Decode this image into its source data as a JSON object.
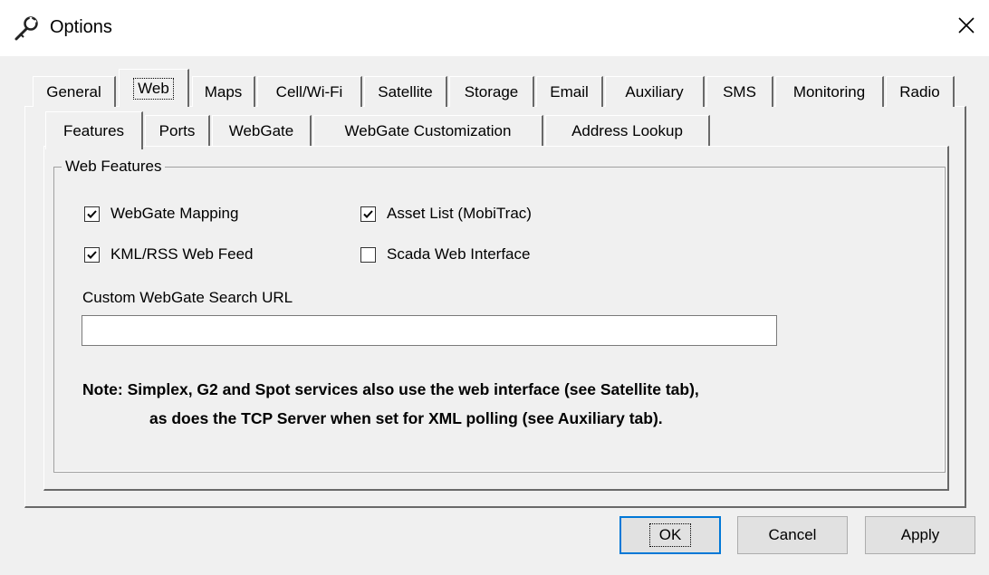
{
  "window": {
    "title": "Options",
    "icon": "wrench-key-icon"
  },
  "outer_tabs": [
    {
      "label": "General"
    },
    {
      "label": "Web",
      "active": true
    },
    {
      "label": "Maps"
    },
    {
      "label": "Cell/Wi-Fi"
    },
    {
      "label": "Satellite"
    },
    {
      "label": "Storage"
    },
    {
      "label": "Email"
    },
    {
      "label": "Auxiliary"
    },
    {
      "label": "SMS"
    },
    {
      "label": "Monitoring"
    },
    {
      "label": "Radio"
    }
  ],
  "inner_tabs": [
    {
      "label": "Features",
      "active": true
    },
    {
      "label": "Ports"
    },
    {
      "label": "WebGate"
    },
    {
      "label": "WebGate Customization"
    },
    {
      "label": "Address Lookup"
    }
  ],
  "web_features": {
    "group_label": "Web Features",
    "checkboxes": [
      {
        "label": "WebGate Mapping",
        "checked": true
      },
      {
        "label": "Asset List (MobiTrac)",
        "checked": true
      },
      {
        "label": "KML/RSS Web Feed",
        "checked": true
      },
      {
        "label": "Scada Web Interface",
        "checked": false
      }
    ],
    "search_url_label": "Custom WebGate Search URL",
    "search_url_value": "",
    "note_line1": "Note:  Simplex, G2 and Spot services also use the web interface (see Satellite tab),",
    "note_line2": "as does the TCP Server when set for XML polling (see Auxiliary tab)."
  },
  "buttons": {
    "ok": "OK",
    "cancel": "Cancel",
    "apply": "Apply"
  }
}
